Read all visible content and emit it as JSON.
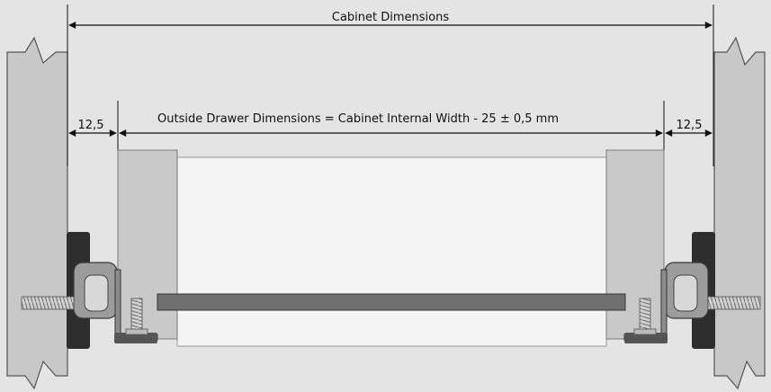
{
  "diagram": {
    "cabinet_dimensions_label": "Cabinet Dimensions",
    "outside_drawer_label": "Outside Drawer Dimensions = Cabinet Internal Width - 25 ± 0,5 mm",
    "left_gap_label": "12,5",
    "right_gap_label": "12,5"
  },
  "colors": {
    "background": "#e4e4e4",
    "cabinet_wall": "#c8c8c8",
    "drawer_side": "#c9c9c9",
    "drawer_front": "#f4f4f4",
    "drawer_bottom": "#707070",
    "bracket_dark": "#2e2e2e",
    "line": "#111111"
  }
}
